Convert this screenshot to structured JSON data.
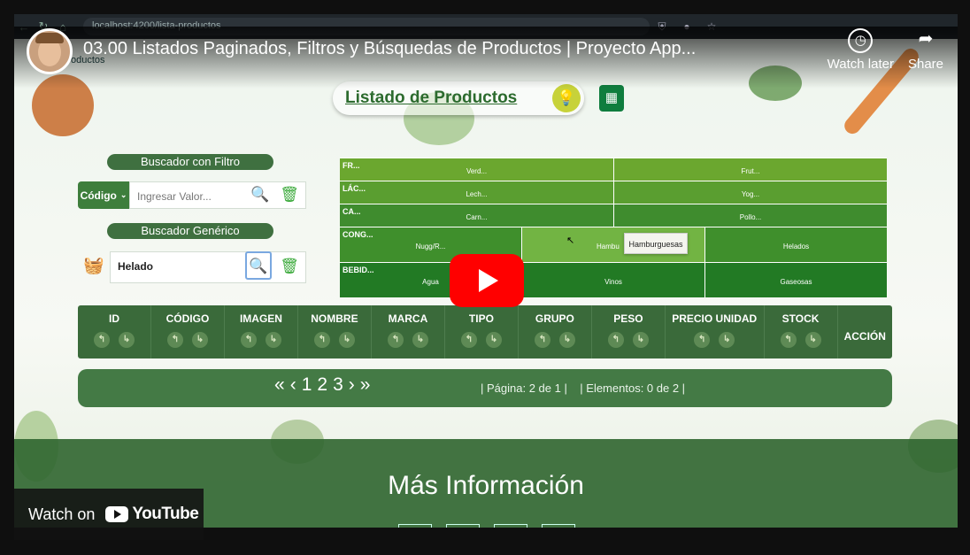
{
  "browser": {
    "url": "localhost:4200/lista-productos"
  },
  "youtube": {
    "video_title": "03.00 Listados Paginados, Filtros y Búsquedas de Productos | Proyecto App...",
    "watch_later_label": "Watch later",
    "share_label": "Share",
    "watch_on_label": "Watch on",
    "brand": "YouTube"
  },
  "header": {
    "logo_text": "oductos",
    "list_title": "Listado de Productos"
  },
  "filter_search": {
    "title": "Buscador con Filtro",
    "select_value": "Código",
    "placeholder": "Ingresar Valor..."
  },
  "generic_search": {
    "title": "Buscador Genérico",
    "value": "Helado"
  },
  "categories": [
    {
      "label": "FR...",
      "items": [
        "Verd...",
        "Frut..."
      ]
    },
    {
      "label": "LÁC...",
      "items": [
        "Lech...",
        "Yog..."
      ]
    },
    {
      "label": "CA...",
      "items": [
        "Carn...",
        "Pollo..."
      ]
    },
    {
      "label": "CONG...",
      "items": [
        "Nugg/R...",
        "Hambu",
        "Helados"
      ]
    },
    {
      "label": "BEBID...",
      "items": [
        "Agua",
        "Vinos",
        "Gaseosas"
      ]
    }
  ],
  "tooltip": "Hamburguesas",
  "table": {
    "columns": [
      "ID",
      "CÓDIGO",
      "IMAGEN",
      "NOMBRE",
      "MARCA",
      "TIPO",
      "GRUPO",
      "PESO",
      "PRECIO UNIDAD",
      "STOCK"
    ],
    "action_label": "ACCIÓN"
  },
  "pagination": {
    "first": "«",
    "prev": "‹",
    "pages": [
      "1",
      "2",
      "3"
    ],
    "next": "›",
    "last": "»",
    "page_info": "| Página: 2 de 1 |",
    "elements_info": "| Elementos: 0 de 2 |"
  },
  "footer": {
    "title": "Más Información"
  },
  "colors": {
    "green_light": "#6aa832",
    "green_mid": "#4f9a35",
    "green_dark": "#2f7e2c",
    "highlight": "#7dbb4a"
  },
  "icons": [
    "back-icon",
    "forward-icon",
    "home-icon",
    "search-icon",
    "trash-icon",
    "bulb-icon",
    "sheets-icon",
    "basket-icon",
    "clock-icon",
    "share-icon",
    "play-icon"
  ]
}
